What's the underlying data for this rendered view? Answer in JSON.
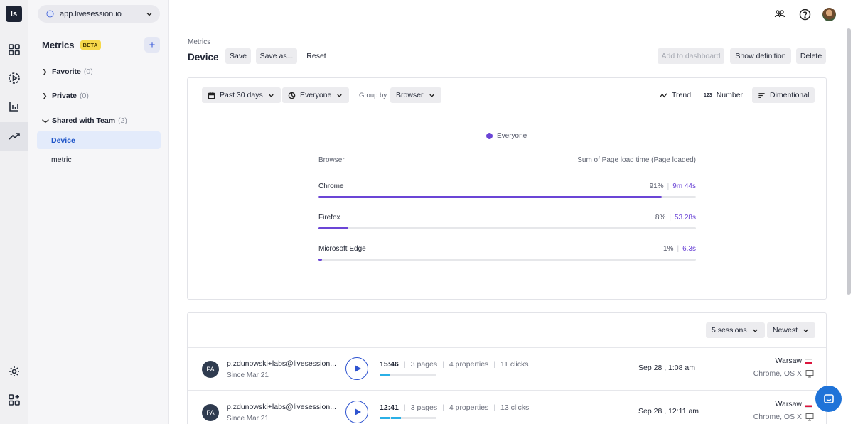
{
  "app": {
    "logo_text": "ls",
    "domain": "app.livesession.io"
  },
  "sidebar": {
    "title": "Metrics",
    "beta_badge": "BETA",
    "add_label": "+",
    "folders": [
      {
        "name": "Favorite",
        "count": "(0)"
      },
      {
        "name": "Private",
        "count": "(0)"
      },
      {
        "name": "Shared with Team",
        "count": "(2)"
      }
    ],
    "items": [
      {
        "label": "Device",
        "active": true
      },
      {
        "label": "metric",
        "active": false
      }
    ]
  },
  "header": {
    "breadcrumb": "Metrics",
    "title": "Device",
    "save_label": "Save",
    "save_as_label": "Save as...",
    "reset_label": "Reset",
    "add_dashboard_label": "Add to dashboard",
    "show_definition_label": "Show definition",
    "delete_label": "Delete"
  },
  "chart_toolbar": {
    "date_range": "Past 30 days",
    "segment": "Everyone",
    "group_by_label": "Group by",
    "group_by_value": "Browser",
    "views": [
      {
        "label": "Trend",
        "icon": "trend-icon"
      },
      {
        "label": "Number",
        "icon": "number-icon"
      },
      {
        "label": "Dimentional",
        "icon": "dimensional-icon",
        "active": true
      }
    ]
  },
  "chart_data": {
    "type": "bar",
    "orientation": "horizontal",
    "legend": [
      "Everyone"
    ],
    "xlabel": "Browser",
    "ylabel": "Sum of Page load time (Page loaded)",
    "categories": [
      "Chrome",
      "Firefox",
      "Microsoft Edge"
    ],
    "series": [
      {
        "name": "Everyone",
        "percent": [
          91,
          8,
          1
        ],
        "percent_labels": [
          "91%",
          "8%",
          "1%"
        ],
        "durations": [
          "9m 44s",
          "53.28s",
          "6.3s"
        ],
        "color": "#6b45d6"
      }
    ]
  },
  "sessions": {
    "count_label": "5 sessions",
    "sort_label": "Newest",
    "rows": [
      {
        "initials": "PA",
        "email": "p.zdunowski+labs@livesession...",
        "since": "Since Mar 21",
        "duration": "15:46",
        "pages": "3 pages",
        "properties": "4 properties",
        "clicks": "11 clicks",
        "date": "Sep 28 , 1:08 am",
        "city": "Warsaw",
        "client": "Chrome, OS X",
        "activity_segments": [
          [
            0,
            0.18
          ]
        ]
      },
      {
        "initials": "PA",
        "email": "p.zdunowski+labs@livesession...",
        "since": "Since Mar 21",
        "duration": "12:41",
        "pages": "3 pages",
        "properties": "4 properties",
        "clicks": "13 clicks",
        "date": "Sep 28 , 12:11 am",
        "city": "Warsaw",
        "client": "Chrome, OS X",
        "activity_segments": [
          [
            0,
            0.18
          ],
          [
            0.2,
            0.38
          ]
        ]
      }
    ]
  },
  "colors": {
    "accent": "#2f54d0",
    "bar": "#6b45d6",
    "beta": "#f6d84a",
    "activity": "#2bb0e6"
  }
}
